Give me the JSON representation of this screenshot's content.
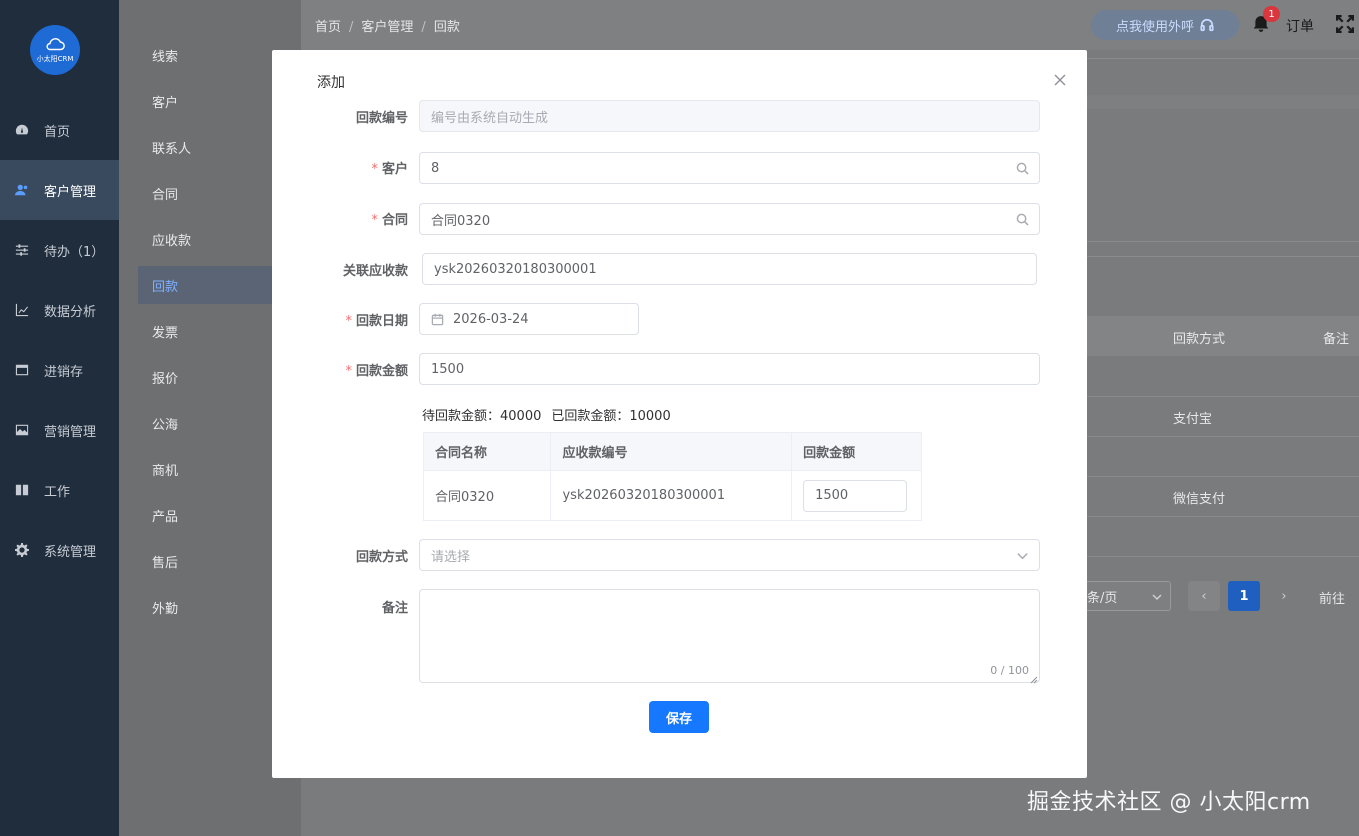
{
  "app": {
    "logo_text": "小太阳CRM",
    "watermark": "掘金技术社区 @ 小太阳crm"
  },
  "sidebar": {
    "items": [
      {
        "label": "首页",
        "icon": "dashboard-icon"
      },
      {
        "label": "客户管理",
        "icon": "users-icon",
        "active": true
      },
      {
        "label": "待办（1）",
        "icon": "sliders-icon"
      },
      {
        "label": "数据分析",
        "icon": "line-chart-icon"
      },
      {
        "label": "进销存",
        "icon": "window-icon"
      },
      {
        "label": "营销管理",
        "icon": "image-icon"
      },
      {
        "label": "工作",
        "icon": "book-icon"
      },
      {
        "label": "系统管理",
        "icon": "gear-icon"
      }
    ]
  },
  "submenu": {
    "items": [
      "线索",
      "客户",
      "联系人",
      "合同",
      "应收款",
      "回款",
      "发票",
      "报价",
      "公海",
      "商机",
      "产品",
      "售后",
      "外勤"
    ],
    "active_index": 5
  },
  "header": {
    "breadcrumb": [
      "首页",
      "客户管理",
      "回款"
    ],
    "call_button": "点我使用外呼",
    "notification_count": "1",
    "order_label": "订单"
  },
  "background_table": {
    "headers": [
      "回款方式",
      "备注"
    ],
    "rows": [
      "支付宝",
      "微信支付"
    ],
    "page_size": "条/页",
    "current_page": "1",
    "goto_label": "前往"
  },
  "dialog": {
    "title": "添加",
    "fields": {
      "payment_no": {
        "label": "回款编号",
        "placeholder": "编号由系统自动生成"
      },
      "customer": {
        "label": "客户",
        "value": "8",
        "required": true
      },
      "contract": {
        "label": "合同",
        "value": "合同0320",
        "required": true
      },
      "receivable": {
        "label": "关联应收款",
        "value": "ysk20260320180300001"
      },
      "date": {
        "label": "回款日期",
        "value": "2026-03-24",
        "required": true
      },
      "amount": {
        "label": "回款金额",
        "value": "1500",
        "required": true
      },
      "method": {
        "label": "回款方式",
        "placeholder": "请选择"
      },
      "remark": {
        "label": "备注",
        "counter": "0 / 100"
      }
    },
    "summary": {
      "pending": "待回款金额：40000",
      "received": "已回款金额：10000"
    },
    "table": {
      "headers": [
        "合同名称",
        "应收款编号",
        "回款金额"
      ],
      "rows": [
        {
          "contract_name": "合同0320",
          "receivable_no": "ysk20260320180300001",
          "amount": "1500"
        }
      ]
    },
    "save_label": "保存"
  }
}
